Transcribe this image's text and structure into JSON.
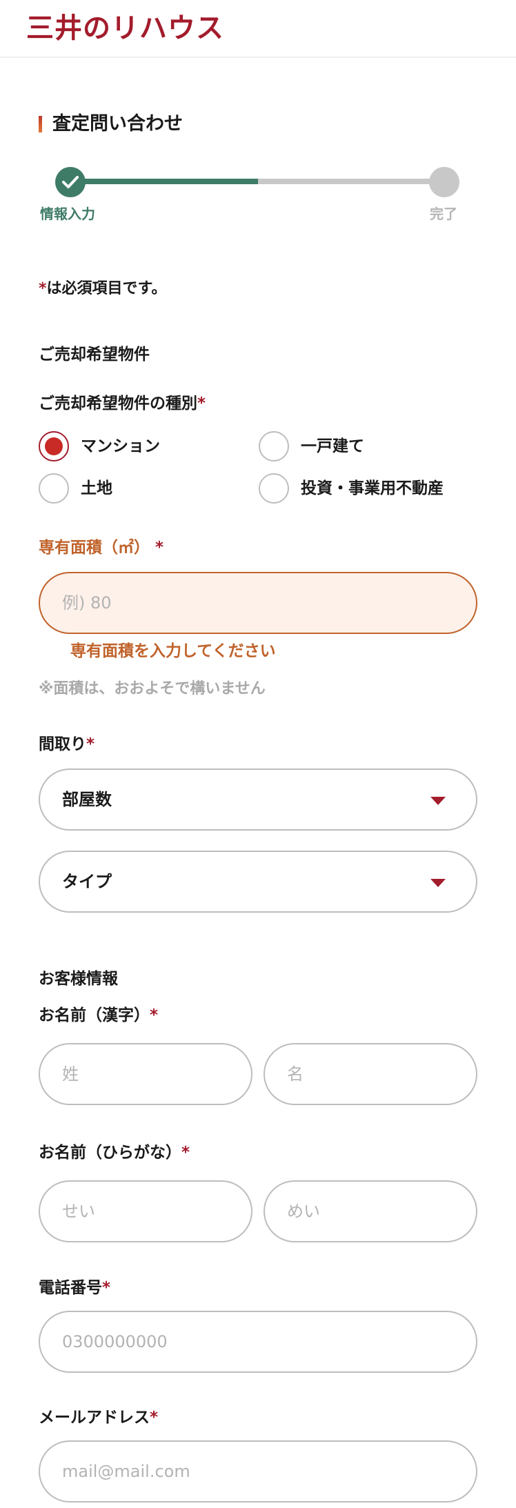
{
  "header": {
    "logo_text": "三井のリハウス"
  },
  "page": {
    "title": "査定問い合わせ"
  },
  "stepper": {
    "steps": [
      {
        "label": "情報入力",
        "status": "done"
      },
      {
        "label": "完了",
        "status": "todo"
      }
    ],
    "progress": 0.5,
    "done_color": "#3f7c68",
    "todo_color": "#c8c8c8"
  },
  "required_note": {
    "mark": "*",
    "text": "は必須項目です。"
  },
  "property_section": {
    "heading": "ご売却希望物件",
    "type_label": "ご売却希望物件の種別",
    "type_options": [
      {
        "label": "マンション",
        "checked": true
      },
      {
        "label": "一戸建て",
        "checked": false
      },
      {
        "label": "土地",
        "checked": false
      },
      {
        "label": "投資・事業用不動産",
        "checked": false
      }
    ],
    "area_label": "専有面積（㎡）",
    "area_placeholder": "例) 80",
    "area_error": "専有面積を入力してください",
    "area_hint": "※面積は、おおよそで構いません",
    "layout_label": "間取り",
    "rooms_select": "部屋数",
    "type_select": "タイプ"
  },
  "customer_section": {
    "heading": "お客様情報",
    "name_kanji_label": "お名前（漢字）",
    "last_name_placeholder": "姓",
    "first_name_placeholder": "名",
    "name_kana_label": "お名前（ひらがな）",
    "last_kana_placeholder": "せい",
    "first_kana_placeholder": "めい",
    "phone_label": "電話番号",
    "phone_placeholder": "0300000000",
    "email_label": "メールアドレス",
    "email_placeholder": "mail@mail.com"
  },
  "required_mark": "*",
  "colors": {
    "brand": "#a31c2c",
    "error": "#c0622a",
    "error_bg": "#fdf1ea"
  }
}
